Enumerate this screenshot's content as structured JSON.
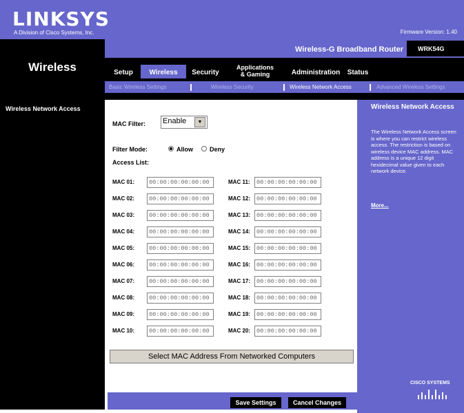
{
  "header": {
    "brand": "LINKSYS",
    "brand_sub": "A Division of Cisco Systems, Inc.",
    "firmware": "Firmware Version: 1.40",
    "page_title": "Wireless",
    "product_name": "Wireless-G Broadband Router",
    "model": "WRK54G"
  },
  "nav": {
    "tabs": [
      "Setup",
      "Wireless",
      "Security",
      "Applications\n& Gaming",
      "Administration",
      "Status"
    ],
    "subtabs": [
      "Basic Wireless Settings",
      "Wireless Security",
      "Wireless Network Access",
      "Advanced Wireless Settings"
    ]
  },
  "left": {
    "section_title": "Wireless Network Access"
  },
  "form": {
    "mac_filter_label": "MAC Filter:",
    "mac_filter_value": "Enable",
    "filter_mode_label": "Filter Mode:",
    "mode_allow": "Allow",
    "mode_deny": "Deny",
    "access_list_label": "Access List:",
    "macs": [
      {
        "label": "MAC 01:",
        "value": "00:00:00:00:00:00"
      },
      {
        "label": "MAC 02:",
        "value": "00:00:00:00:00:00"
      },
      {
        "label": "MAC 03:",
        "value": "00:00:00:00:00:00"
      },
      {
        "label": "MAC 04:",
        "value": "00:00:00:00:00:00"
      },
      {
        "label": "MAC 05:",
        "value": "00:00:00:00:00:00"
      },
      {
        "label": "MAC 06:",
        "value": "00:00:00:00:00:00"
      },
      {
        "label": "MAC 07:",
        "value": "00:00:00:00:00:00"
      },
      {
        "label": "MAC 08:",
        "value": "00:00:00:00:00:00"
      },
      {
        "label": "MAC 09:",
        "value": "00:00:00:00:00:00"
      },
      {
        "label": "MAC 10:",
        "value": "00:00:00:00:00:00"
      },
      {
        "label": "MAC 11:",
        "value": "00:00:00:00:00:00"
      },
      {
        "label": "MAC 12:",
        "value": "00:00:00:00:00:00"
      },
      {
        "label": "MAC 13:",
        "value": "00:00:00:00:00:00"
      },
      {
        "label": "MAC 14:",
        "value": "00:00:00:00:00:00"
      },
      {
        "label": "MAC 15:",
        "value": "00:00:00:00:00:00"
      },
      {
        "label": "MAC 16:",
        "value": "00:00:00:00:00:00"
      },
      {
        "label": "MAC 17:",
        "value": "00:00:00:00:00:00"
      },
      {
        "label": "MAC 18:",
        "value": "00:00:00:00:00:00"
      },
      {
        "label": "MAC 19:",
        "value": "00:00:00:00:00:00"
      },
      {
        "label": "MAC 20:",
        "value": "00:00:00:00:00:00"
      }
    ],
    "select_mac_button": "Select MAC Address From Networked Computers"
  },
  "help": {
    "title": "Wireless Network Access",
    "text": "The Wireless Network Access screen is where you can restrict wireless access. The restriction is based on wireless device MAC address. MAC address is a unique 12 digit hexidecimal value given to each network device.",
    "more": "More..."
  },
  "footer": {
    "save": "Save Settings",
    "cancel": "Cancel Changes",
    "cisco": "CISCO SYSTEMS"
  },
  "colors": {
    "brand_purple": "#6666cc",
    "black": "#000000"
  }
}
